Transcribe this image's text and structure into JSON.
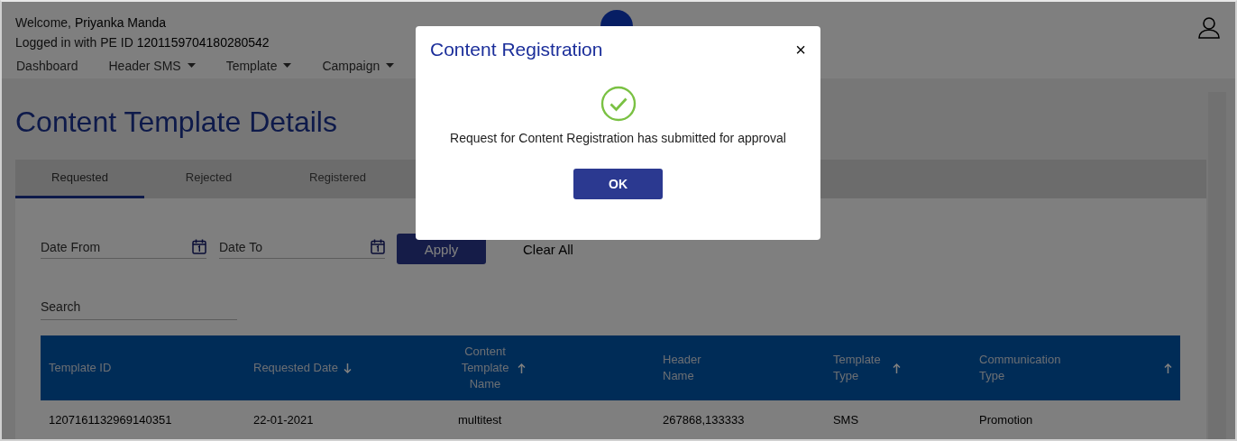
{
  "header": {
    "welcome_label": "Welcome,",
    "user_name": "Priyanka Manda",
    "login_label": "Logged in with PE ID",
    "pe_id": "1201159704180280542"
  },
  "nav": [
    {
      "label": "Dashboard",
      "dropdown": false
    },
    {
      "label": "Header SMS",
      "dropdown": true
    },
    {
      "label": "Template",
      "dropdown": true
    },
    {
      "label": "Campaign",
      "dropdown": true
    }
  ],
  "page_title": "Content Template Details",
  "tabs": [
    {
      "label": "Requested",
      "selected": true
    },
    {
      "label": "Rejected",
      "selected": false
    },
    {
      "label": "Registered",
      "selected": false
    }
  ],
  "filters": {
    "date_from": {
      "placeholder": "Date From"
    },
    "date_to": {
      "placeholder": "Date To"
    },
    "apply": "Apply",
    "clear": "Clear All",
    "search": {
      "placeholder": "Search"
    }
  },
  "table": {
    "columns": [
      {
        "label": "Template ID",
        "sorted_up": false,
        "sorted_down": false
      },
      {
        "label": "Requested Date",
        "sorted_up": false,
        "sorted_down": true
      },
      {
        "label": "Content Template Name",
        "sorted_up": true,
        "sorted_down": false
      },
      {
        "label": "Header Name",
        "sorted_up": false,
        "sorted_down": false
      },
      {
        "label": "Template Type",
        "sorted_up": true,
        "sorted_down": false
      },
      {
        "label": "Communication Type",
        "sorted_up": true,
        "sorted_down": false
      }
    ],
    "rows": [
      [
        "1207161132969140351",
        "22-01-2021",
        "multitest",
        "267868,133333",
        "SMS",
        "Promotion"
      ]
    ]
  },
  "modal": {
    "title": "Content Registration",
    "close": "×",
    "message": "Request for Content Registration has submitted for approval",
    "ok": "OK"
  }
}
